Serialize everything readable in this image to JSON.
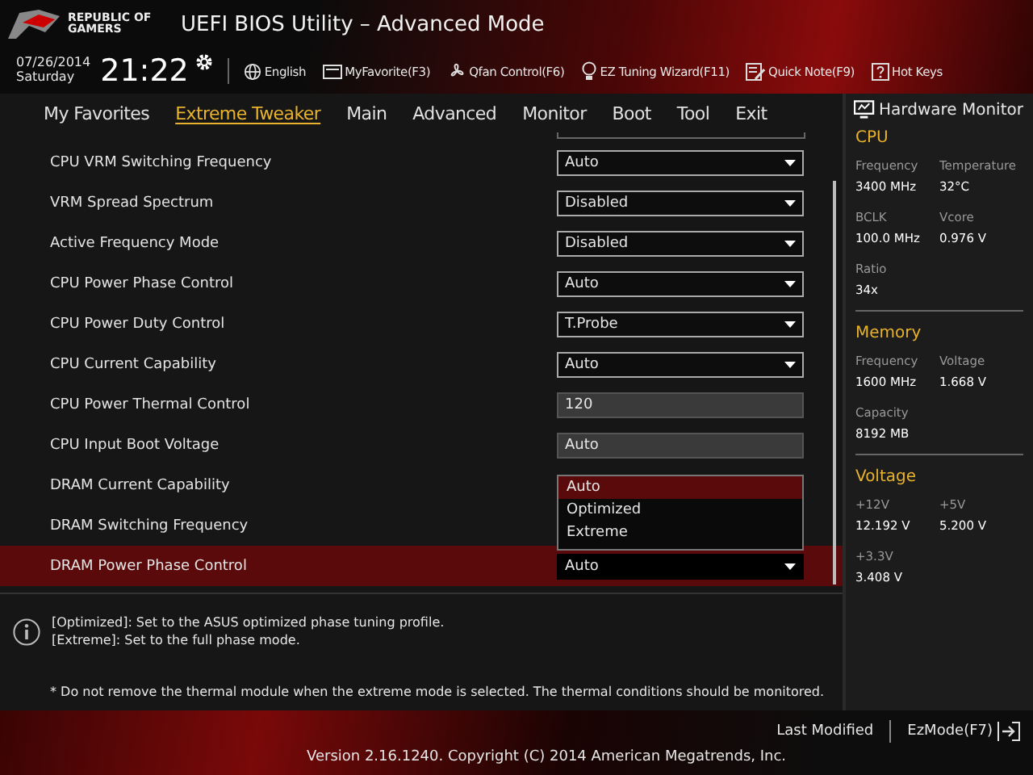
{
  "header": {
    "logo_text": "REPUBLIC OF GAMERS",
    "title": "UEFI BIOS Utility – Advanced Mode"
  },
  "toolbar": {
    "date": "07/26/2014",
    "weekday": "Saturday",
    "time": "21:22",
    "items": [
      {
        "label": "English",
        "kind": "globe"
      },
      {
        "label": "MyFavorite(F3)",
        "kind": "favorite"
      },
      {
        "label": "Qfan Control(F6)",
        "kind": "fan"
      },
      {
        "label": "EZ Tuning Wizard(F11)",
        "kind": "wizard"
      },
      {
        "label": "Quick Note(F9)",
        "kind": "note"
      },
      {
        "label": "Hot Keys",
        "kind": "help"
      }
    ]
  },
  "tabs": [
    {
      "label": "My Favorites",
      "selected": false
    },
    {
      "label": "Extreme Tweaker",
      "selected": true
    },
    {
      "label": "Main",
      "selected": false
    },
    {
      "label": "Advanced",
      "selected": false
    },
    {
      "label": "Monitor",
      "selected": false
    },
    {
      "label": "Boot",
      "selected": false
    },
    {
      "label": "Tool",
      "selected": false
    },
    {
      "label": "Exit",
      "selected": false
    }
  ],
  "settings": [
    {
      "label": "CPU VRM Switching Frequency",
      "kind": "dropdown",
      "value": "Auto",
      "selected": false
    },
    {
      "label": "VRM Spread Spectrum",
      "kind": "dropdown",
      "value": "Disabled",
      "selected": false
    },
    {
      "label": "Active Frequency Mode",
      "kind": "dropdown",
      "value": "Disabled",
      "selected": false
    },
    {
      "label": "CPU Power Phase Control",
      "kind": "dropdown",
      "value": "Auto",
      "selected": false
    },
    {
      "label": "CPU Power Duty Control",
      "kind": "dropdown",
      "value": "T.Probe",
      "selected": false
    },
    {
      "label": "CPU Current Capability",
      "kind": "dropdown",
      "value": "Auto",
      "selected": false
    },
    {
      "label": "CPU Power Thermal Control",
      "kind": "field",
      "value": "120",
      "selected": false
    },
    {
      "label": "CPU Input Boot Voltage",
      "kind": "field",
      "value": "Auto",
      "selected": false
    },
    {
      "label": "DRAM Current Capability",
      "kind": "hidden",
      "selected": false
    },
    {
      "label": "DRAM Switching Frequency",
      "kind": "hidden",
      "selected": false
    },
    {
      "label": "DRAM Power Phase Control",
      "kind": "dropdown",
      "value": "Auto",
      "selected": true,
      "menu": [
        {
          "label": "Auto",
          "selected": true
        },
        {
          "label": "Optimized",
          "selected": false
        },
        {
          "label": "Extreme",
          "selected": false
        }
      ]
    }
  ],
  "help": {
    "lines": [
      "[Optimized]: Set to the ASUS optimized phase tuning profile.",
      "[Extreme]: Set to the full phase mode."
    ],
    "note": "* Do not remove the thermal module when the extreme mode is selected. The thermal conditions should be monitored."
  },
  "hardware_monitor": {
    "title": "Hardware Monitor",
    "sections": [
      {
        "title": "CPU",
        "items": [
          {
            "label": "Frequency",
            "value": "3400 MHz"
          },
          {
            "label": "Temperature",
            "value": "32°C"
          },
          {
            "label": "BCLK",
            "value": "100.0 MHz"
          },
          {
            "label": "Vcore",
            "value": "0.976 V"
          },
          {
            "label": "Ratio",
            "value": "34x"
          }
        ]
      },
      {
        "title": "Memory",
        "items": [
          {
            "label": "Frequency",
            "value": "1600 MHz"
          },
          {
            "label": "Voltage",
            "value": "1.668 V"
          },
          {
            "label": "Capacity",
            "value": "8192 MB"
          }
        ]
      },
      {
        "title": "Voltage",
        "items": [
          {
            "label": "+12V",
            "value": "12.192 V"
          },
          {
            "label": "+5V",
            "value": "5.200 V"
          },
          {
            "label": "+3.3V",
            "value": "3.408 V"
          }
        ]
      }
    ]
  },
  "footer": {
    "version": "Version 2.16.1240. Copyright (C) 2014 American Megatrends, Inc.",
    "last_modified": "Last Modified",
    "ez_mode": "EzMode(F7)"
  }
}
